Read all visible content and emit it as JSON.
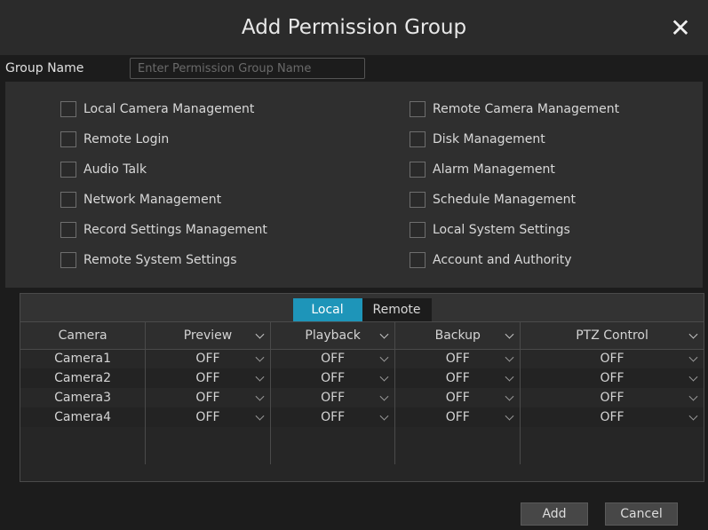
{
  "dialog": {
    "title": "Add Permission Group",
    "close_icon": "close-icon"
  },
  "group_name": {
    "label": "Group Name",
    "value": "",
    "placeholder": "Enter Permission Group Name"
  },
  "permissions": {
    "left": [
      {
        "label": "Local Camera Management",
        "checked": false
      },
      {
        "label": "Remote Login",
        "checked": false
      },
      {
        "label": "Audio Talk",
        "checked": false
      },
      {
        "label": "Network Management",
        "checked": false
      },
      {
        "label": "Record Settings Management",
        "checked": false
      },
      {
        "label": "Remote System Settings",
        "checked": false
      }
    ],
    "right": [
      {
        "label": "Remote Camera Management",
        "checked": false
      },
      {
        "label": "Disk Management",
        "checked": false
      },
      {
        "label": "Alarm Management",
        "checked": false
      },
      {
        "label": "Schedule Management",
        "checked": false
      },
      {
        "label": "Local System Settings",
        "checked": false
      },
      {
        "label": "Account and Authority",
        "checked": false
      }
    ]
  },
  "tabs": [
    {
      "label": "Local",
      "active": true
    },
    {
      "label": "Remote",
      "active": false
    }
  ],
  "table": {
    "headers": [
      "Camera",
      "Preview",
      "Playback",
      "Backup",
      "PTZ Control"
    ],
    "rows": [
      {
        "camera": "Camera1",
        "preview": "OFF",
        "playback": "OFF",
        "backup": "OFF",
        "ptz": "OFF"
      },
      {
        "camera": "Camera2",
        "preview": "OFF",
        "playback": "OFF",
        "backup": "OFF",
        "ptz": "OFF"
      },
      {
        "camera": "Camera3",
        "preview": "OFF",
        "playback": "OFF",
        "backup": "OFF",
        "ptz": "OFF"
      },
      {
        "camera": "Camera4",
        "preview": "OFF",
        "playback": "OFF",
        "backup": "OFF",
        "ptz": "OFF"
      }
    ]
  },
  "buttons": {
    "add": "Add",
    "cancel": "Cancel"
  },
  "colors": {
    "accent": "#1e95b9",
    "background": "#1c1c1c",
    "panel": "#2f2f2f",
    "titlebar": "#2b2b2b"
  }
}
